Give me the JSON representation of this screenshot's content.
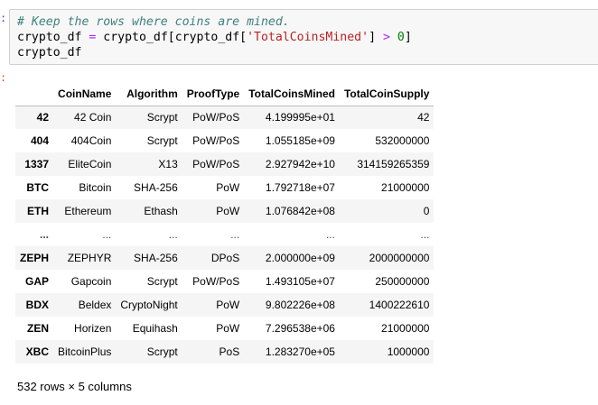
{
  "notebook": {
    "in_prompt": ":",
    "out_prompt": ":",
    "code": {
      "comment": "# Keep the rows where coins are mined.",
      "line2_a": "crypto_df ",
      "line2_eq": "=",
      "line2_b": " crypto_df[crypto_df[",
      "line2_str": "'TotalCoinsMined'",
      "line2_c": "] ",
      "line2_gt": ">",
      "line2_d": " ",
      "line2_num": "0",
      "line2_e": "]",
      "line3": "crypto_df"
    }
  },
  "dataframe": {
    "columns": [
      "",
      "CoinName",
      "Algorithm",
      "ProofType",
      "TotalCoinsMined",
      "TotalCoinSupply"
    ],
    "rows": [
      {
        "index": "42",
        "cells": [
          "42 Coin",
          "Scrypt",
          "PoW/PoS",
          "4.199995e+01",
          "42"
        ]
      },
      {
        "index": "404",
        "cells": [
          "404Coin",
          "Scrypt",
          "PoW/PoS",
          "1.055185e+09",
          "532000000"
        ]
      },
      {
        "index": "1337",
        "cells": [
          "EliteCoin",
          "X13",
          "PoW/PoS",
          "2.927942e+10",
          "314159265359"
        ]
      },
      {
        "index": "BTC",
        "cells": [
          "Bitcoin",
          "SHA-256",
          "PoW",
          "1.792718e+07",
          "21000000"
        ]
      },
      {
        "index": "ETH",
        "cells": [
          "Ethereum",
          "Ethash",
          "PoW",
          "1.076842e+08",
          "0"
        ]
      },
      {
        "index": "...",
        "cells": [
          "...",
          "...",
          "...",
          "...",
          "..."
        ]
      },
      {
        "index": "ZEPH",
        "cells": [
          "ZEPHYR",
          "SHA-256",
          "DPoS",
          "2.000000e+09",
          "2000000000"
        ]
      },
      {
        "index": "GAP",
        "cells": [
          "Gapcoin",
          "Scrypt",
          "PoW/PoS",
          "1.493105e+07",
          "250000000"
        ]
      },
      {
        "index": "BDX",
        "cells": [
          "Beldex",
          "CryptoNight",
          "PoW",
          "9.802226e+08",
          "1400222610"
        ]
      },
      {
        "index": "ZEN",
        "cells": [
          "Horizen",
          "Equihash",
          "PoW",
          "7.296538e+06",
          "21000000"
        ]
      },
      {
        "index": "XBC",
        "cells": [
          "BitcoinPlus",
          "Scrypt",
          "PoS",
          "1.283270e+05",
          "1000000"
        ]
      }
    ],
    "shape_text": "532 rows × 5 columns"
  }
}
